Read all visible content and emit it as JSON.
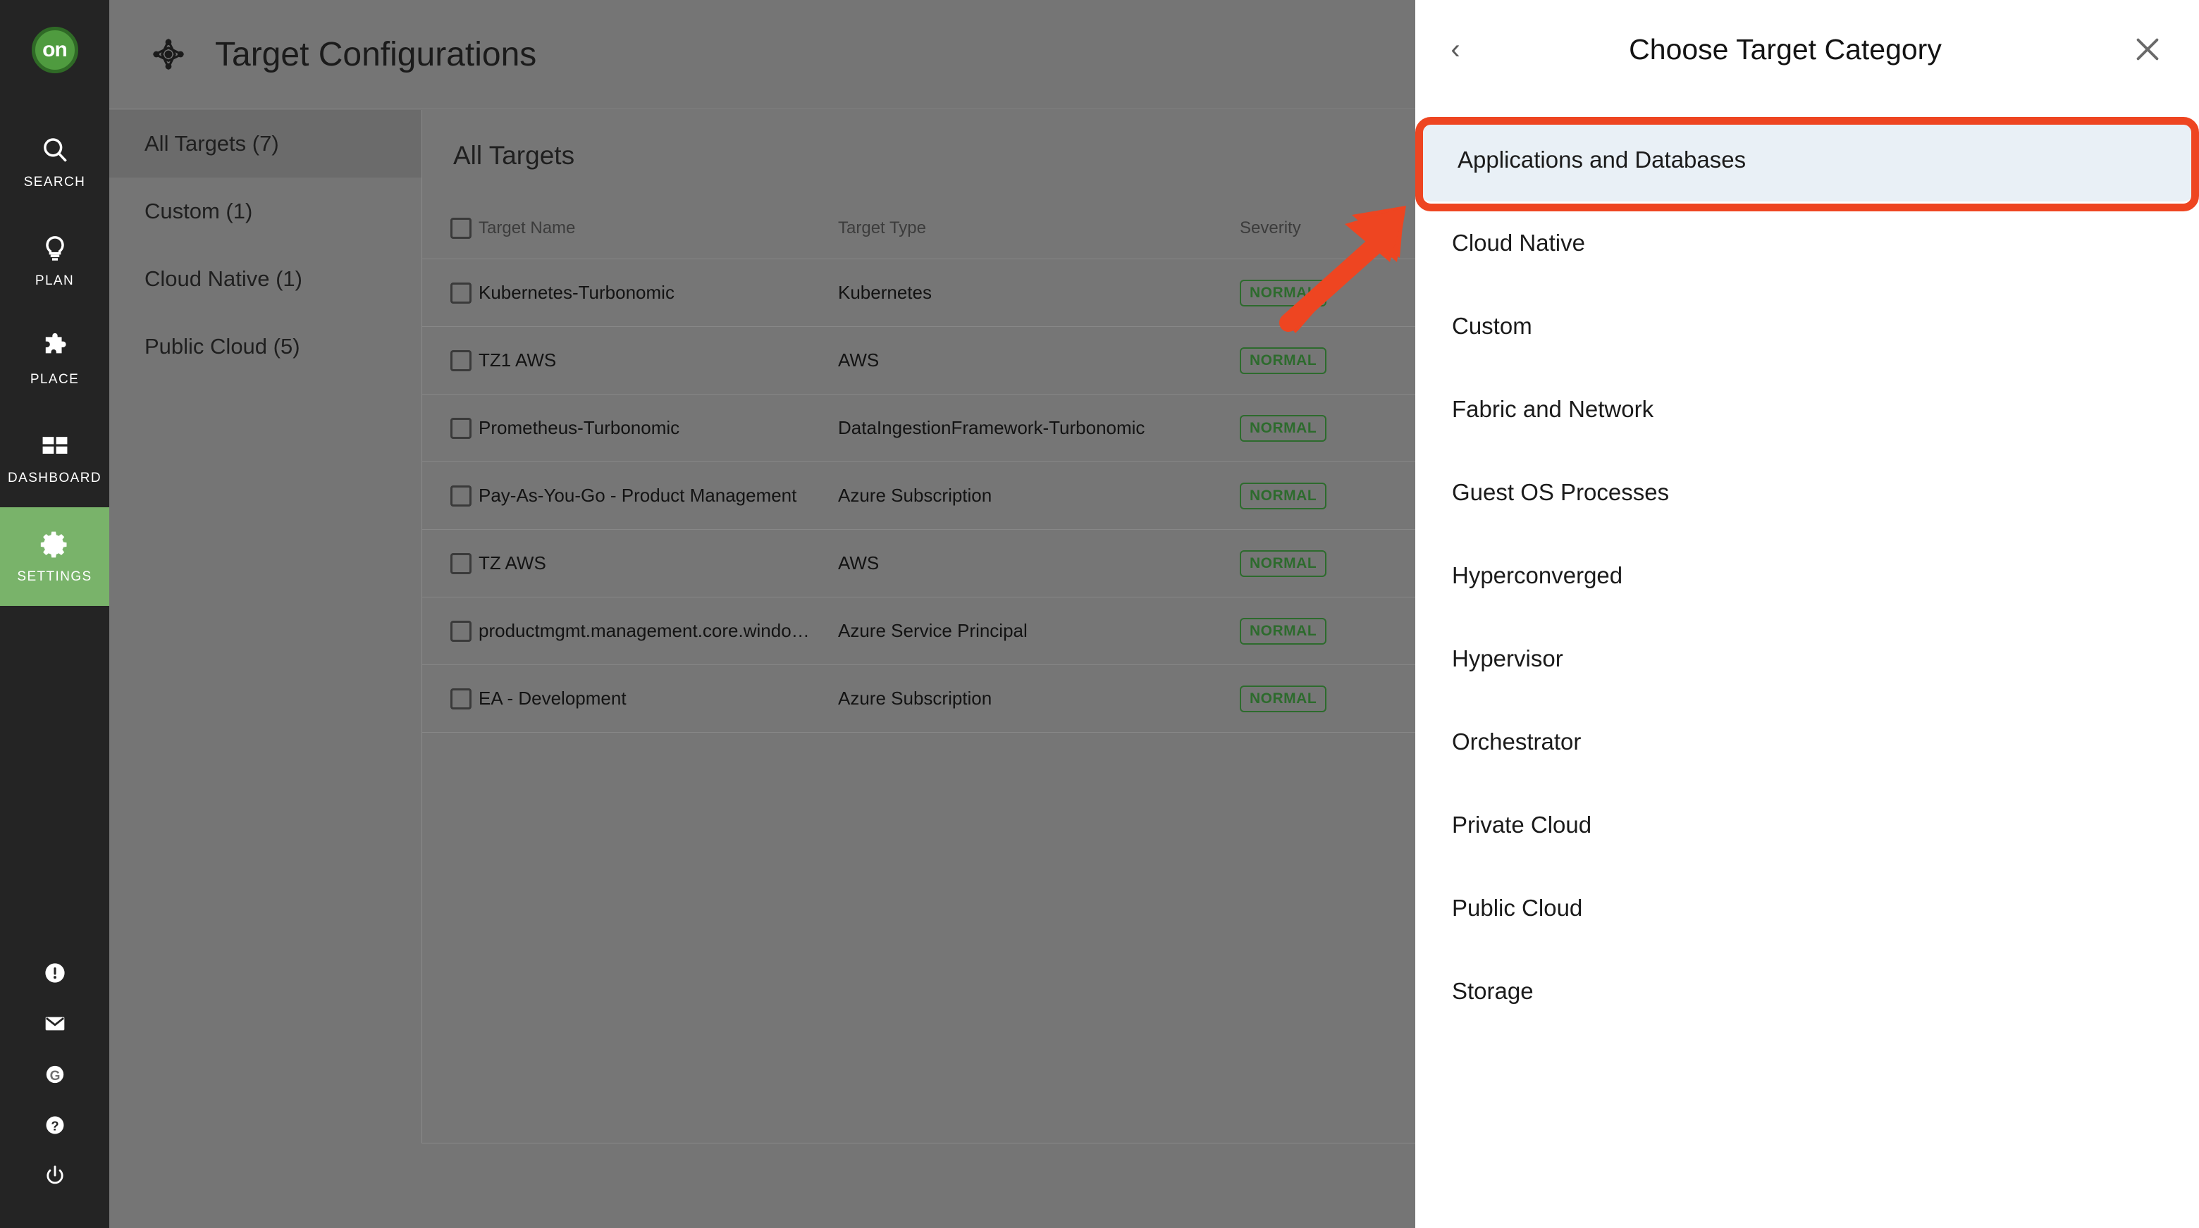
{
  "nav": {
    "logo_text": "on",
    "items": [
      {
        "label": "SEARCH",
        "icon": "search-icon",
        "active": false
      },
      {
        "label": "PLAN",
        "icon": "lightbulb-icon",
        "active": false
      },
      {
        "label": "PLACE",
        "icon": "puzzle-icon",
        "active": false
      },
      {
        "label": "DASHBOARD",
        "icon": "dashboard-icon",
        "active": false
      },
      {
        "label": "SETTINGS",
        "icon": "gear-icon",
        "active": true
      }
    ],
    "bottom_icons": [
      "alert-icon",
      "mail-icon",
      "globe-icon",
      "help-icon",
      "power-icon"
    ]
  },
  "header": {
    "icon": "target-crosshair-icon",
    "title": "Target Configurations"
  },
  "filters": {
    "items": [
      {
        "label": "All Targets (7)",
        "selected": true
      },
      {
        "label": "Custom (1)",
        "selected": false
      },
      {
        "label": "Cloud Native (1)",
        "selected": false
      },
      {
        "label": "Public Cloud (5)",
        "selected": false
      }
    ]
  },
  "targets_table": {
    "caption": "All Targets",
    "columns": [
      "Target Name",
      "Target Type",
      "Severity"
    ],
    "rows": [
      {
        "name": "Kubernetes-Turbonomic",
        "type": "Kubernetes",
        "severity": "NORMAL"
      },
      {
        "name": "TZ1 AWS",
        "type": "AWS",
        "severity": "NORMAL"
      },
      {
        "name": "Prometheus-Turbonomic",
        "type": "DataIngestionFramework-Turbonomic",
        "severity": "NORMAL"
      },
      {
        "name": "Pay-As-You-Go - Product Management",
        "type": "Azure Subscription",
        "severity": "NORMAL"
      },
      {
        "name": "TZ AWS",
        "type": "AWS",
        "severity": "NORMAL"
      },
      {
        "name": "productmgmt.management.core.windo…",
        "type": "Azure Service Principal",
        "severity": "NORMAL"
      },
      {
        "name": "EA - Development",
        "type": "Azure Subscription",
        "severity": "NORMAL"
      }
    ]
  },
  "side_panel": {
    "back_icon": "chevron-left-icon",
    "title": "Choose Target Category",
    "close_icon": "close-icon",
    "categories": [
      {
        "label": "Applications and Databases",
        "selected": true
      },
      {
        "label": "Cloud Native",
        "selected": false
      },
      {
        "label": "Custom",
        "selected": false
      },
      {
        "label": "Fabric and Network",
        "selected": false
      },
      {
        "label": "Guest OS Processes",
        "selected": false
      },
      {
        "label": "Hyperconverged",
        "selected": false
      },
      {
        "label": "Hypervisor",
        "selected": false
      },
      {
        "label": "Orchestrator",
        "selected": false
      },
      {
        "label": "Private Cloud",
        "selected": false
      },
      {
        "label": "Public Cloud",
        "selected": false
      },
      {
        "label": "Storage",
        "selected": false
      }
    ]
  },
  "annotation": {
    "highlight_color": "#ee4521",
    "arrow_color": "#ee4521"
  },
  "colors": {
    "nav_bg": "#242424",
    "nav_active": "#79b36a",
    "dim_overlay": "#757575",
    "accent_green": "#4f9b3f",
    "badge_green": "#2d6b2d",
    "selected_item_bg": "#e9f0f6"
  }
}
